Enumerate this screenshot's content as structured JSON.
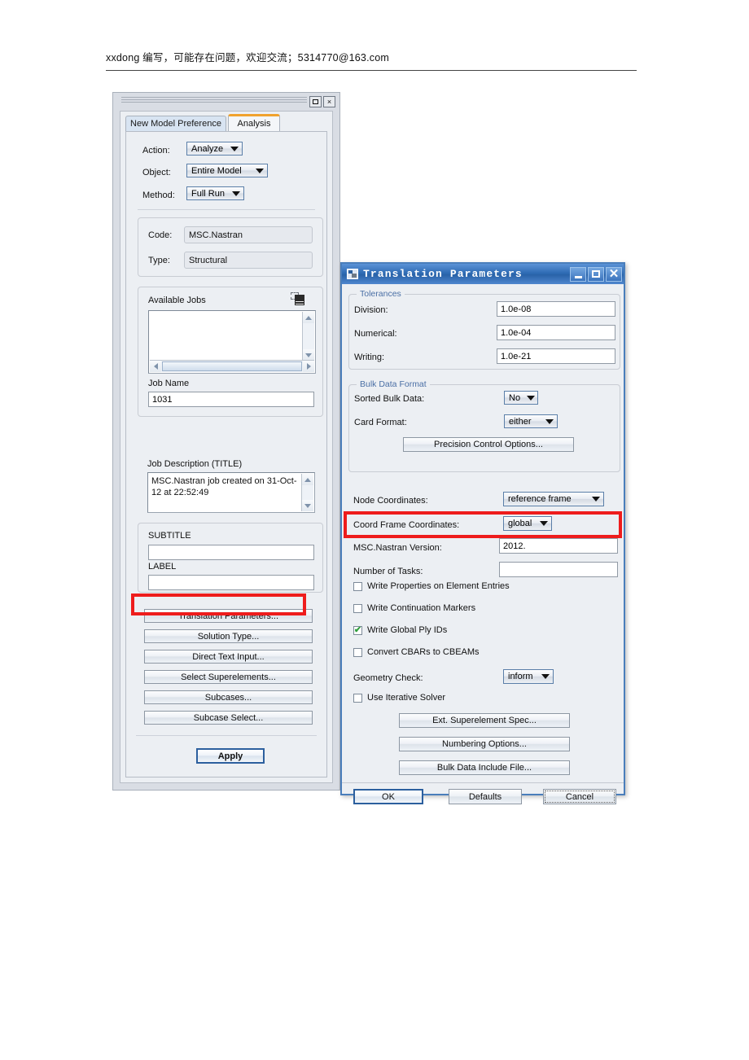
{
  "page": {
    "header_text": "xxdong 编写，可能存在问题，欢迎交流；5314770@163.com"
  },
  "analysis_window": {
    "window_buttons": [
      {
        "name": "maximize",
        "glyph": "□"
      },
      {
        "name": "close",
        "glyph": "×"
      }
    ],
    "tabs": [
      {
        "label": "New Model Preference",
        "active": false
      },
      {
        "label": "Analysis",
        "active": true
      }
    ],
    "form": {
      "action_label": "Action:",
      "action_value": "Analyze",
      "object_label": "Object:",
      "object_value": "Entire Model",
      "method_label": "Method:",
      "method_value": "Full Run",
      "code_label": "Code:",
      "code_value": "MSC.Nastran",
      "type_label": "Type:",
      "type_value": "Structural"
    },
    "jobs": {
      "available_jobs_label": "Available Jobs",
      "available_jobs_items": [],
      "job_name_label": "Job Name",
      "job_name_value": "1031",
      "job_description_label": "Job Description (TITLE)",
      "job_description_value": "MSC.Nastran job created on 31-Oct-12 at 22:52:49"
    },
    "text_fields": {
      "subtitle_label": "SUBTITLE",
      "subtitle_value": "",
      "label_label": "LABEL",
      "label_value": ""
    },
    "buttons": [
      {
        "label": "Translation Parameters...",
        "highlighted": true
      },
      {
        "label": "Solution Type...",
        "highlighted": false
      },
      {
        "label": "Direct Text Input...",
        "highlighted": false
      },
      {
        "label": "Select Superelements...",
        "highlighted": false
      },
      {
        "label": "Subcases...",
        "highlighted": false
      },
      {
        "label": "Subcase Select...",
        "highlighted": false
      }
    ],
    "apply_label": "Apply"
  },
  "translation_dialog": {
    "title": "Translation Parameters",
    "title_buttons": [
      {
        "name": "minimize",
        "glyph": "minimize-icon"
      },
      {
        "name": "maximize",
        "glyph": "maximize-icon"
      },
      {
        "name": "close",
        "glyph": "close-icon"
      }
    ],
    "tolerances": {
      "group_title": "Tolerances",
      "rows": [
        {
          "label": "Division:",
          "value": "1.0e-08"
        },
        {
          "label": "Numerical:",
          "value": "1.0e-04"
        },
        {
          "label": "Writing:",
          "value": "1.0e-21"
        }
      ]
    },
    "bulk_data_format": {
      "group_title": "Bulk Data Format",
      "sorted_bulk_data_label": "Sorted Bulk Data:",
      "sorted_bulk_data_value": "No",
      "card_format_label": "Card Format:",
      "card_format_value": "either",
      "precision_button": "Precision Control Options..."
    },
    "coordinates": {
      "node_coordinates_label": "Node Coordinates:",
      "node_coordinates_value": "reference frame",
      "coord_frame_label": "Coord Frame Coordinates:",
      "coord_frame_value": "global",
      "version_label": "MSC.Nastran Version:",
      "version_value": "2012.",
      "tasks_label": "Number of Tasks:",
      "tasks_value": ""
    },
    "checkboxes": [
      {
        "label": "Write Properties on Element Entries",
        "checked": false
      },
      {
        "label": "Write Continuation Markers",
        "checked": false
      },
      {
        "label": "Write Global Ply IDs",
        "checked": true
      },
      {
        "label": "Convert CBARs to CBEAMs",
        "checked": false
      }
    ],
    "geometry_check_label": "Geometry Check:",
    "geometry_check_value": "inform",
    "iterative_solver": {
      "label": "Use Iterative Solver",
      "checked": false
    },
    "option_buttons": [
      {
        "label": "Ext. Superelement Spec..."
      },
      {
        "label": "Numbering Options..."
      },
      {
        "label": "Bulk Data Include File..."
      }
    ],
    "action_buttons": [
      {
        "label": "OK",
        "style": "primary"
      },
      {
        "label": "Defaults",
        "style": "normal"
      },
      {
        "label": "Cancel",
        "style": "focus"
      }
    ]
  },
  "highlights": {
    "accent_red": "#ee1c1c",
    "tab_accent": "#f0a22e",
    "titlebar_blue": "#2f6cb5"
  }
}
